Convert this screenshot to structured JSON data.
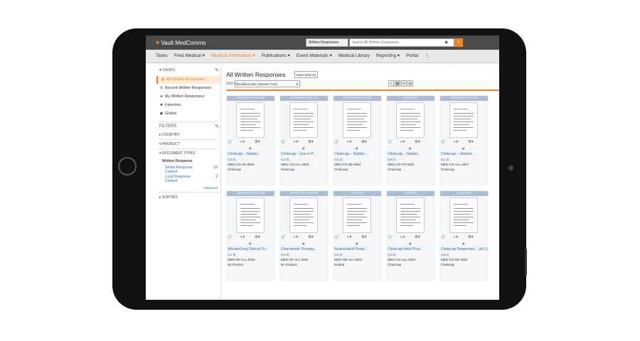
{
  "app": {
    "logo": "Vault MedComms",
    "search_scope": "Written Responses",
    "search_placeholder": "Search All Written Responses"
  },
  "nav": [
    "Tasks",
    "Field Medical ▾",
    "Medical Information ▾",
    "Publications ▾",
    "Event Materials ▾",
    "Medical Library",
    "Reporting ▾",
    "Portal",
    "⋮"
  ],
  "sidebar": {
    "views_label": "VIEWS",
    "views": [
      {
        "icon": "▮",
        "label": "All Written Responses"
      },
      {
        "icon": "◷",
        "label": "Recent Written Responses"
      },
      {
        "icon": "●",
        "label": "My Written Responses"
      },
      {
        "icon": "★",
        "label": "Favorites"
      },
      {
        "icon": "◉",
        "label": "Global"
      }
    ],
    "filters_label": "FILTERS",
    "filters": [
      "COUNTRY",
      "PRODUCT",
      "DOCUMENT TYPES"
    ],
    "doc_type_group": "Written Response",
    "doc_types": [
      {
        "label": "Global Response Content",
        "count": "12"
      },
      {
        "label": "Local Response Content",
        "count": "2"
      }
    ],
    "advanced": "Advanced",
    "sorties": "SORTIES"
  },
  "main": {
    "title": "All Written Responses",
    "save_view": "Save View As",
    "sort_label": "Sort by",
    "sort_value": "Modified Date (Newest First)"
  },
  "cards": [
    {
      "status": "APPROVED FOR USE",
      "title": "Cholecap – Statisti...",
      "version": "(v1.0)",
      "number": "MED-CO-UK-0004",
      "product": "Cholecap"
    },
    {
      "status": "APPROVED FOR USE",
      "title": "Cholecap – Use in P...",
      "version": "(v1.0)",
      "number": "MED-CO-ALL-0003",
      "product": "Cholecap"
    },
    {
      "status": "APPROVED FOR USE",
      "title": "Cholecap – Statisti...",
      "version": "(v1.0)",
      "number": "MED-CO-DE-0002",
      "product": "Cholecap"
    },
    {
      "status": "REVIEWED",
      "title": "Cholecap – Statisti...",
      "version": "(v0.1)",
      "number": "MED-CO-FR-0002",
      "product": "Cholecap"
    },
    {
      "status": "APPROVED FOR USE",
      "title": "Cholecap – Skeleta...",
      "version": "(v1.0)",
      "number": "MED-CO-ALL-0007",
      "product": "Cholecap"
    },
    {
      "status": "APPROVED FOR USE",
      "title": "WonderDrug Clinical Tri...",
      "version": "(v1.0)",
      "number": "MED-NP-ALL-0002",
      "product": "No Product"
    },
    {
      "status": "APPROVED FOR USE",
      "title": "Charcamide Therapy...",
      "version": "(v1.0)",
      "number": "MED-NP-ALL-0001",
      "product": "No Product"
    },
    {
      "status": "EXPIRED",
      "title": "Nodeal Adult Produ...",
      "version": "(v1.0)",
      "number": "MED-ND-ALL-0003",
      "product": "Nodeal"
    },
    {
      "status": "EXPIRED",
      "title": "Cholecap Adult Prod...",
      "version": "(v1.0)",
      "number": "MED-CO-ALL-0003",
      "product": "Cholecap"
    },
    {
      "status": "IN REVIEW",
      "title": "Cholecap Responses... (v0.1)",
      "version": "(v0.1)",
      "number": "MED-CO-DE-0002",
      "product": "Cholecap"
    }
  ],
  "colors": {
    "accent": "#f58220",
    "topbar": "#4a4a4a",
    "badge": "#a9bed6",
    "link": "#2a6cb5"
  }
}
